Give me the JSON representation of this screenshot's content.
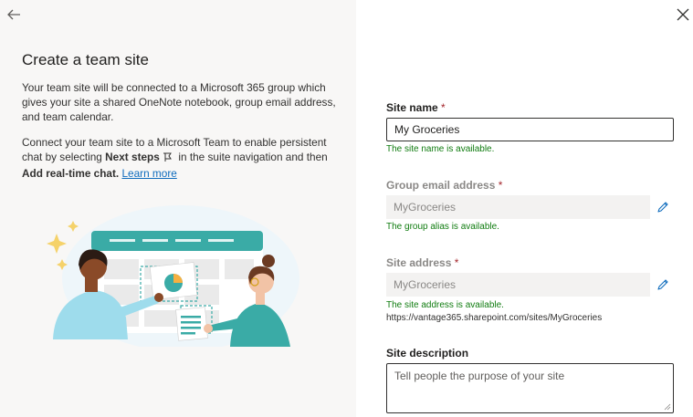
{
  "panel": {
    "title": "Create a team site",
    "intro": "Your team site will be connected to a Microsoft 365 group which gives your site a shared OneNote notebook, group email address, and team calendar.",
    "connect_text_1": "Connect your team site to a Microsoft Team to enable persistent chat by selecting ",
    "connect_bold_1": "Next steps",
    "connect_text_2": " in the suite navigation and then ",
    "connect_bold_2": "Add real-time chat.",
    "learn_more": "Learn more"
  },
  "form": {
    "site_name": {
      "label": "Site name",
      "required_mark": "*",
      "value": "My Groceries",
      "status": "The site name is available."
    },
    "group_email": {
      "label": "Group email address",
      "required_mark": "*",
      "value": "MyGroceries",
      "status": "The group alias is available."
    },
    "site_address": {
      "label": "Site address",
      "required_mark": "*",
      "value": "MyGroceries",
      "status": "The site address is available.",
      "url": "https://vantage365.sharepoint.com/sites/MyGroceries"
    },
    "site_description": {
      "label": "Site description",
      "placeholder": "Tell people the purpose of your site"
    }
  },
  "icons": {
    "back": "arrow-left-icon",
    "close": "close-icon",
    "edit": "pencil-icon",
    "next_steps": "flag-icon"
  },
  "colors": {
    "left_panel_bg": "#f8f7f6",
    "success": "#107c10",
    "required": "#a4262c",
    "link": "#0f6cbd",
    "readonly_bg": "#f3f2f1",
    "illustration_teal": "#3aaba6"
  }
}
